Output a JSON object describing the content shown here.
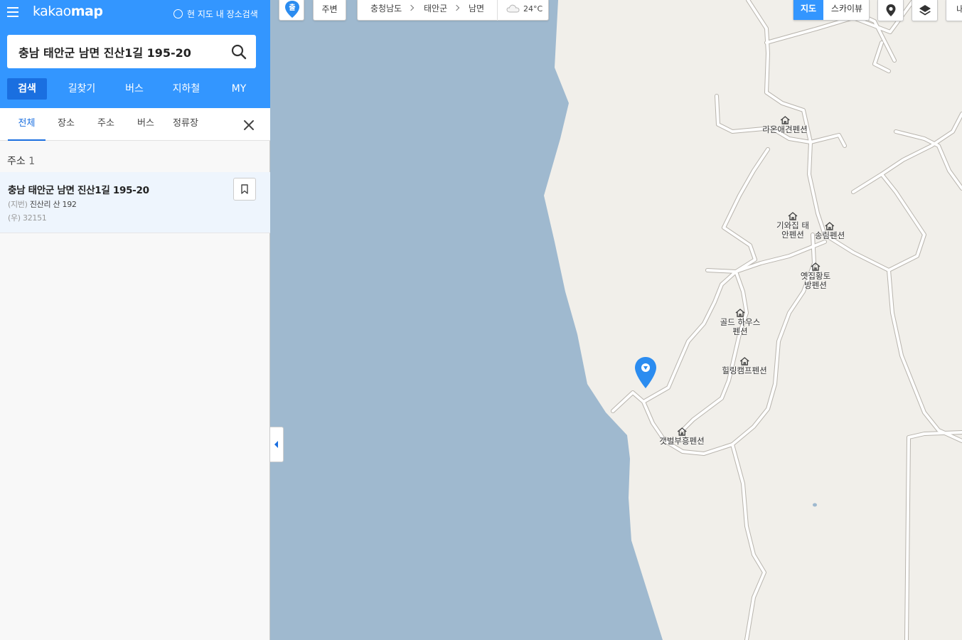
{
  "sidebar": {
    "brand_light": "kakao",
    "brand_bold": "map",
    "current_map_search": "현 지도 내 장소검색",
    "search_value": "충남 태안군 남면 진산1길 195-20",
    "main_tabs": [
      "검색",
      "길찾기",
      "버스",
      "지하철",
      "MY"
    ],
    "sub_tabs": [
      "전체",
      "장소",
      "주소",
      "버스",
      "정류장"
    ],
    "results_label": "주소",
    "results_count": "1",
    "result": {
      "title": "충남 태안군 남면 진산1길 195-20",
      "jibun_label": "(지번)",
      "jibun": "진산리 산 192",
      "postal_label": "(우)",
      "postal": "32151"
    }
  },
  "map": {
    "departure_badge": "출",
    "around": "주변",
    "region": [
      "충청남도",
      "태안군",
      "남면"
    ],
    "temperature": "24°C",
    "map_types": [
      "지도",
      "스카이뷰"
    ],
    "my_place": "내",
    "labels": [
      "라온애견펜션",
      "기와집 태안펜션",
      "송림펜션",
      "옛집황토 방펜션",
      "골드 하우스펜션",
      "힐링캠프펜션",
      "갯벌부흥펜션"
    ]
  },
  "colors": {
    "brand_blue": "#3396ff",
    "active_blue": "#1a6fe0",
    "sea": "#9fb9cf",
    "land": "#f1efea",
    "road_outline": "#b8b4ad",
    "marker": "#2b8cf0"
  },
  "icons": [
    "menu-icon",
    "search-icon",
    "close-icon",
    "bookmark-icon",
    "departure-marker-icon",
    "cloud-icon",
    "location-icon",
    "layers-icon",
    "pension-icon",
    "map-pin-icon",
    "collapse-arrow-icon"
  ]
}
